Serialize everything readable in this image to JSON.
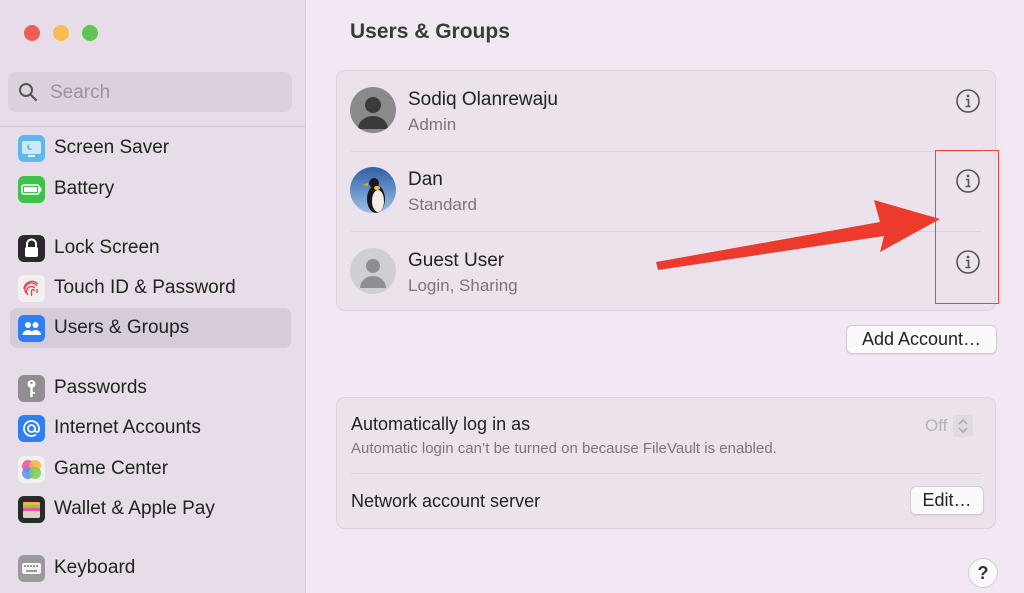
{
  "window": {
    "traffic_lights": [
      {
        "name": "close",
        "color": "#ee5e57"
      },
      {
        "name": "minimize",
        "color": "#f5be4f"
      },
      {
        "name": "zoom",
        "color": "#5fc453"
      }
    ]
  },
  "sidebar": {
    "search": {
      "placeholder": "Search",
      "value": ""
    },
    "items": [
      {
        "label": "Screen Saver",
        "icon": "screen-saver-icon",
        "color": "#5cb9f0"
      },
      {
        "label": "Battery",
        "icon": "battery-icon",
        "color": "#3ec24a"
      },
      {
        "label": "Lock Screen",
        "icon": "lock-icon",
        "color": "#2a2a2a"
      },
      {
        "label": "Touch ID & Password",
        "icon": "fingerprint-icon",
        "color": "#f1f1f1"
      },
      {
        "label": "Users & Groups",
        "icon": "users-icon",
        "color": "#2f7ff2",
        "selected": true
      },
      {
        "label": "Passwords",
        "icon": "key-icon",
        "color": "#8e8e93"
      },
      {
        "label": "Internet Accounts",
        "icon": "at-sign-icon",
        "color": "#2f7ff2"
      },
      {
        "label": "Game Center",
        "icon": "game-center-icon",
        "color": "#f1f1f1"
      },
      {
        "label": "Wallet & Apple Pay",
        "icon": "wallet-icon",
        "color": "#2a2a2a"
      },
      {
        "label": "Keyboard",
        "icon": "keyboard-icon",
        "color": "#9a9a9e"
      }
    ]
  },
  "main": {
    "title": "Users & Groups",
    "users": [
      {
        "name": "Sodiq Olanrewaju",
        "role": "Admin",
        "avatar": "person-avatar-icon"
      },
      {
        "name": "Dan",
        "role": "Standard",
        "avatar": "penguin-avatar-icon"
      },
      {
        "name": "Guest User",
        "role": "Login, Sharing",
        "avatar": "person-avatar-icon"
      }
    ],
    "add_account_label": "Add Account…",
    "auto_login": {
      "title": "Automatically log in as",
      "subtitle": "Automatic login can’t be turned on because FileVault is enabled.",
      "value": "Off"
    },
    "network_server": {
      "title": "Network account server",
      "edit_label": "Edit…"
    },
    "help_label": "?"
  },
  "annotation": {
    "color": "#e8453c"
  }
}
